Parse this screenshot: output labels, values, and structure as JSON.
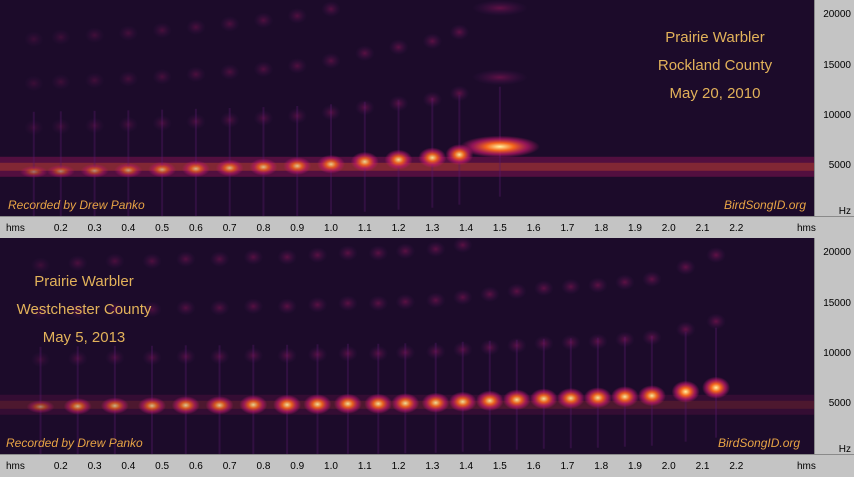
{
  "chart_data": [
    {
      "type": "heatmap",
      "title_lines": [
        "Prairie Warbler",
        "Rockland County",
        "May 20, 2010"
      ],
      "credit": "Recorded by Drew Panko",
      "site": "BirdSongID.org",
      "x_ticks": [
        "0.2",
        "0.3",
        "0.4",
        "0.5",
        "0.6",
        "0.7",
        "0.8",
        "0.9",
        "1.0",
        "1.1",
        "1.2",
        "1.3",
        "1.4",
        "1.5",
        "1.6",
        "1.7",
        "1.8",
        "1.9",
        "2.0",
        "2.1",
        "2.2"
      ],
      "x_unit": "hms",
      "xlim": [
        0.02,
        2.43
      ],
      "y_ticks": [
        "20000",
        "15000",
        "10000",
        "5000"
      ],
      "y_unit": "Hz",
      "ylim": [
        0,
        21500
      ],
      "notes": [
        {
          "t": 0.12,
          "f": 4400,
          "i": 0.45
        },
        {
          "t": 0.2,
          "f": 4450,
          "i": 0.5
        },
        {
          "t": 0.3,
          "f": 4500,
          "i": 0.55
        },
        {
          "t": 0.4,
          "f": 4550,
          "i": 0.6
        },
        {
          "t": 0.5,
          "f": 4620,
          "i": 0.65
        },
        {
          "t": 0.6,
          "f": 4700,
          "i": 0.7
        },
        {
          "t": 0.7,
          "f": 4780,
          "i": 0.72
        },
        {
          "t": 0.8,
          "f": 4870,
          "i": 0.75
        },
        {
          "t": 0.9,
          "f": 4980,
          "i": 0.78
        },
        {
          "t": 1.0,
          "f": 5150,
          "i": 0.82
        },
        {
          "t": 1.1,
          "f": 5400,
          "i": 0.88
        },
        {
          "t": 1.2,
          "f": 5600,
          "i": 0.9
        },
        {
          "t": 1.3,
          "f": 5800,
          "i": 0.92
        },
        {
          "t": 1.38,
          "f": 6100,
          "i": 0.95
        },
        {
          "t": 1.5,
          "f": 6900,
          "i": 1.0
        }
      ],
      "band": {
        "f": 4900,
        "i": 0.55
      }
    },
    {
      "type": "heatmap",
      "title_lines": [
        "Prairie Warbler",
        "Westchester County",
        "May 5, 2013"
      ],
      "credit": "Recorded by Drew Panko",
      "site": "BirdSongID.org",
      "x_ticks": [
        "0.2",
        "0.3",
        "0.4",
        "0.5",
        "0.6",
        "0.7",
        "0.8",
        "0.9",
        "1.0",
        "1.1",
        "1.2",
        "1.3",
        "1.4",
        "1.5",
        "1.6",
        "1.7",
        "1.8",
        "1.9",
        "2.0",
        "2.1",
        "2.2"
      ],
      "x_unit": "hms",
      "xlim": [
        0.02,
        2.43
      ],
      "y_ticks": [
        "20000",
        "15000",
        "10000",
        "5000"
      ],
      "y_unit": "Hz",
      "ylim": [
        0,
        21500
      ],
      "notes": [
        {
          "t": 0.14,
          "f": 4700,
          "i": 0.5
        },
        {
          "t": 0.25,
          "f": 4750,
          "i": 0.7
        },
        {
          "t": 0.36,
          "f": 4800,
          "i": 0.7
        },
        {
          "t": 0.47,
          "f": 4800,
          "i": 0.75
        },
        {
          "t": 0.57,
          "f": 4850,
          "i": 0.8
        },
        {
          "t": 0.67,
          "f": 4850,
          "i": 0.8
        },
        {
          "t": 0.77,
          "f": 4900,
          "i": 0.85
        },
        {
          "t": 0.87,
          "f": 4900,
          "i": 0.9
        },
        {
          "t": 0.96,
          "f": 4950,
          "i": 0.9
        },
        {
          "t": 1.05,
          "f": 5000,
          "i": 0.9
        },
        {
          "t": 1.14,
          "f": 5000,
          "i": 0.9
        },
        {
          "t": 1.22,
          "f": 5050,
          "i": 0.9
        },
        {
          "t": 1.31,
          "f": 5100,
          "i": 0.9
        },
        {
          "t": 1.39,
          "f": 5200,
          "i": 0.9
        },
        {
          "t": 1.47,
          "f": 5300,
          "i": 0.92
        },
        {
          "t": 1.55,
          "f": 5400,
          "i": 0.92
        },
        {
          "t": 1.63,
          "f": 5500,
          "i": 0.92
        },
        {
          "t": 1.71,
          "f": 5550,
          "i": 0.92
        },
        {
          "t": 1.79,
          "f": 5600,
          "i": 0.94
        },
        {
          "t": 1.87,
          "f": 5700,
          "i": 0.95
        },
        {
          "t": 1.95,
          "f": 5800,
          "i": 0.95
        },
        {
          "t": 2.05,
          "f": 6200,
          "i": 1.0
        },
        {
          "t": 2.14,
          "f": 6600,
          "i": 1.0
        }
      ],
      "band": {
        "f": 4900,
        "i": 0.25
      }
    }
  ],
  "colors": {
    "background": "#1c0b2a",
    "low": "#5a1a6e",
    "mid": "#c2186b",
    "high": "#ff6a1a",
    "peak": "#fff3a0",
    "label": "#e2b25a",
    "credit": "#e8a445"
  }
}
